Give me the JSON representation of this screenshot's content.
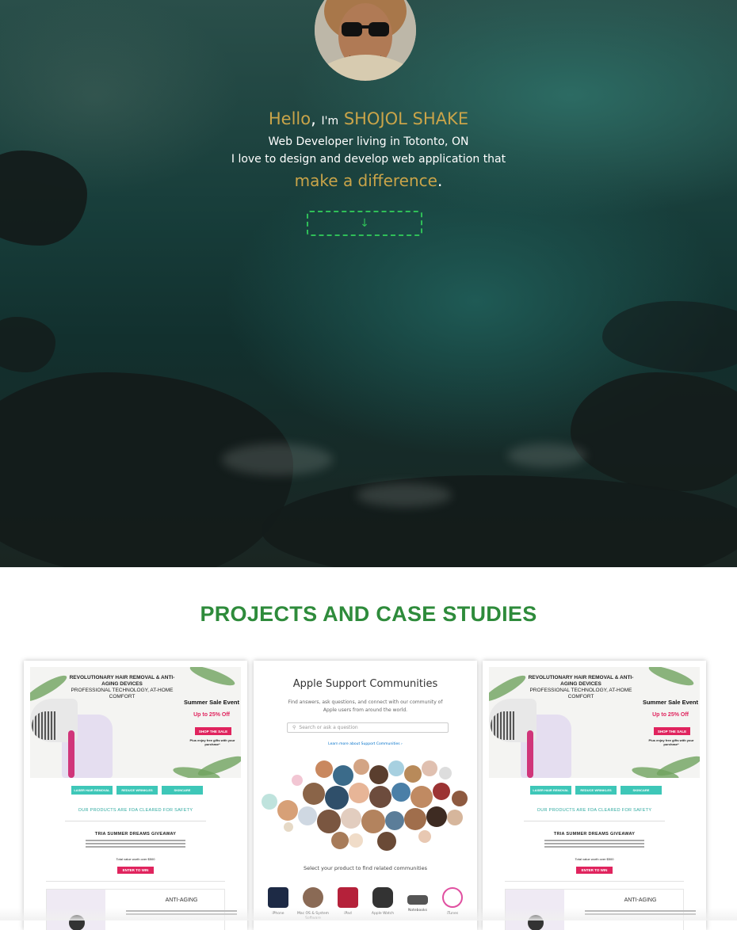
{
  "hero": {
    "hello": "Hello",
    "comma": ",",
    "im": "I'm",
    "name": "SHOJOL SHAKE",
    "role": "Web Developer living in Totonto, ON",
    "tagline": "I love to design and develop web application that",
    "difference": "make a difference",
    "period": ".",
    "down_arrow": "↓"
  },
  "projects": {
    "title": "PROJECTS AND CASE STUDIES",
    "tria": {
      "headline": "REVOLUTIONARY HAIR REMOVAL & ANTI-AGING DEVICES",
      "sub": "PROFESSIONAL TECHNOLOGY, AT-HOME COMFORT",
      "sale": "Summer Sale Event",
      "up_to": "Up to 25% Off",
      "shop": "SHOP THE SALE",
      "gift": "Plus enjoy free gifts with your purchase*",
      "tabs": [
        "LASER HAIR REMOVAL",
        "REDUCE WRINKLES",
        "SKINCARE"
      ],
      "fda": "OUR PRODUCTS ARE FDA CLEARED FOR SAFETY",
      "giveaway": "TRIA SUMMER DREAMS GIVEAWAY",
      "total": "Total value worth over $500",
      "enter": "ENTER TO WIN",
      "anti": "ANTI-AGING"
    },
    "apple": {
      "title": "Apple Support Communities",
      "desc": "Find answers, ask questions, and connect with our community of Apple users from around the world.",
      "search_placeholder": "Search or ask a question",
      "learn": "Learn more about Support Communities ›",
      "select": "Select your product to find related communities",
      "products": [
        "iPhone",
        "Mac OS & System Software",
        "iPad",
        "Apple Watch",
        "Notebooks",
        "iTunes"
      ]
    }
  },
  "colors": {
    "gold": "#c9a449",
    "green_title": "#2e8b3b",
    "button_green": "#2fbf58",
    "accent_pink": "#e0245e",
    "teal": "#3ec7b8"
  }
}
